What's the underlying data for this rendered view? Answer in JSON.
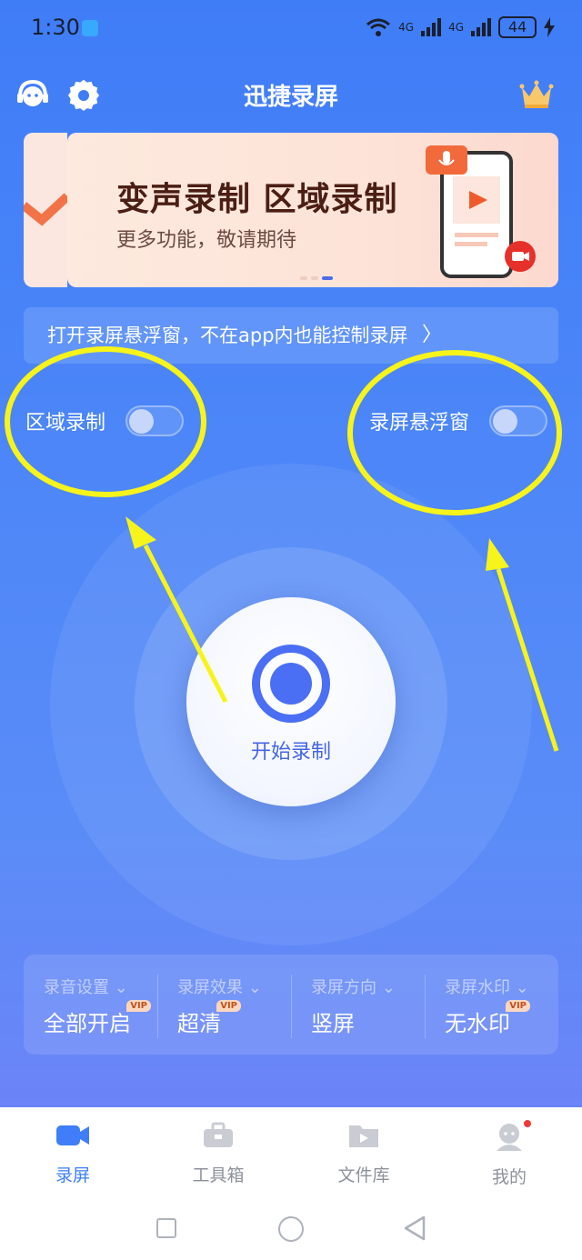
{
  "status_bar": {
    "time": "1:30",
    "battery": "44",
    "network_labels": [
      "4G",
      "4G"
    ]
  },
  "header": {
    "title": "迅捷录屏",
    "icons": [
      "support-icon",
      "settings-icon",
      "crown-icon"
    ]
  },
  "banner": {
    "headline": "变声录制 区域录制",
    "subline": "更多功能，敬请期待",
    "active_slide": 3,
    "slide_count": 3
  },
  "tip": {
    "text": "打开录屏悬浮窗，不在app内也能控制录屏",
    "chevron": "〉"
  },
  "toggles": [
    {
      "label": "区域录制",
      "on": false
    },
    {
      "label": "录屏悬浮窗",
      "on": false
    }
  ],
  "record_button": {
    "label": "开始录制"
  },
  "settings": [
    {
      "label": "录音设置",
      "value": "全部开启",
      "vip": "VIP"
    },
    {
      "label": "录屏效果",
      "value": "超清",
      "vip": "VIP"
    },
    {
      "label": "录屏方向",
      "value": "竖屏",
      "vip": ""
    },
    {
      "label": "录屏水印",
      "value": "无水印",
      "vip": "VIP"
    }
  ],
  "tabs": [
    {
      "label": "录屏",
      "active": true
    },
    {
      "label": "工具箱",
      "active": false
    },
    {
      "label": "文件库",
      "active": false
    },
    {
      "label": "我的",
      "active": false,
      "badge": true
    }
  ],
  "colors": {
    "brand_blue": "#3f7ef8",
    "annotation_yellow": "#f6f41a",
    "badge_red": "#f0393c"
  }
}
